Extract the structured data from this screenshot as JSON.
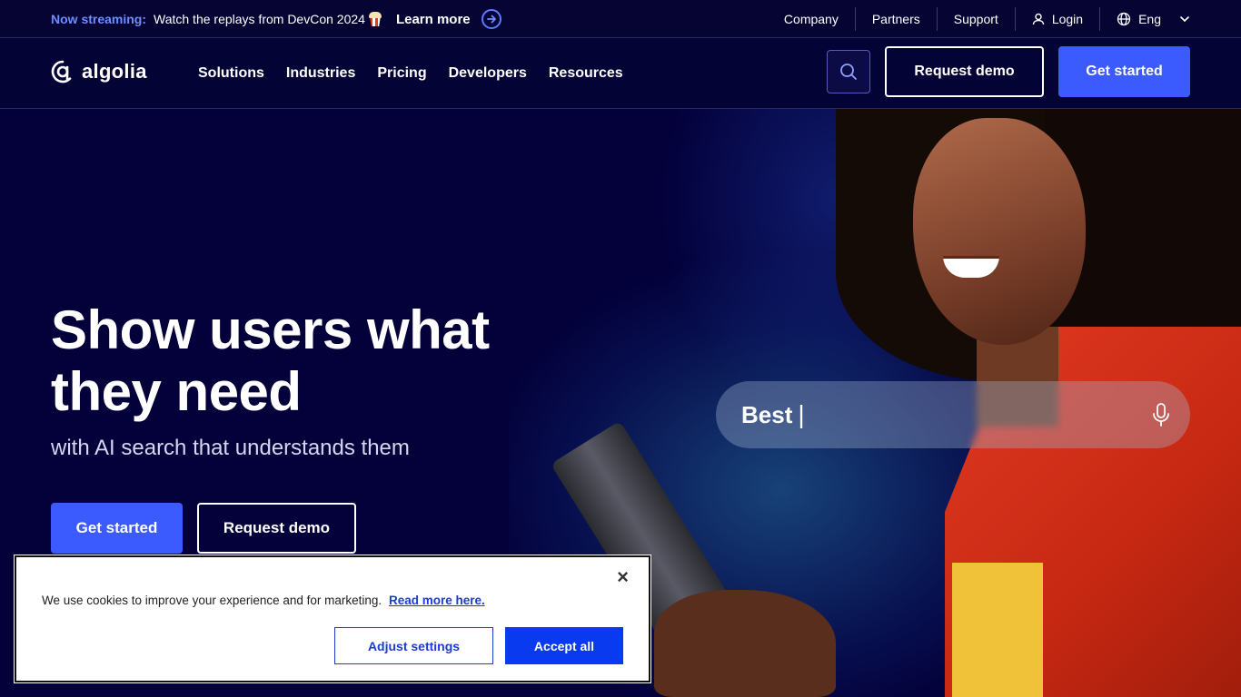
{
  "topbar": {
    "streaming_label": "Now streaming:",
    "announcement": "Watch the replays from DevCon 2024",
    "learn_more": "Learn more",
    "links": [
      "Company",
      "Partners",
      "Support"
    ],
    "login": "Login",
    "language": "Eng"
  },
  "nav": {
    "logo_text": "algolia",
    "menu": [
      "Solutions",
      "Industries",
      "Pricing",
      "Developers",
      "Resources"
    ],
    "request_demo": "Request demo",
    "get_started": "Get started"
  },
  "hero": {
    "title": "Show users what they need",
    "subtitle": "with AI search that understands them",
    "get_started": "Get started",
    "request_demo": "Request demo",
    "search_query": "Best"
  },
  "cookie": {
    "message": "We use cookies to improve your experience and for marketing.",
    "read_more": "Read more here.",
    "adjust": "Adjust settings",
    "accept": "Accept all",
    "close": "×"
  },
  "colors": {
    "background": "#03003a",
    "accent": "#3c5bff",
    "streaming_label": "#6f8dff",
    "cookie_accept": "#0a3af0"
  }
}
